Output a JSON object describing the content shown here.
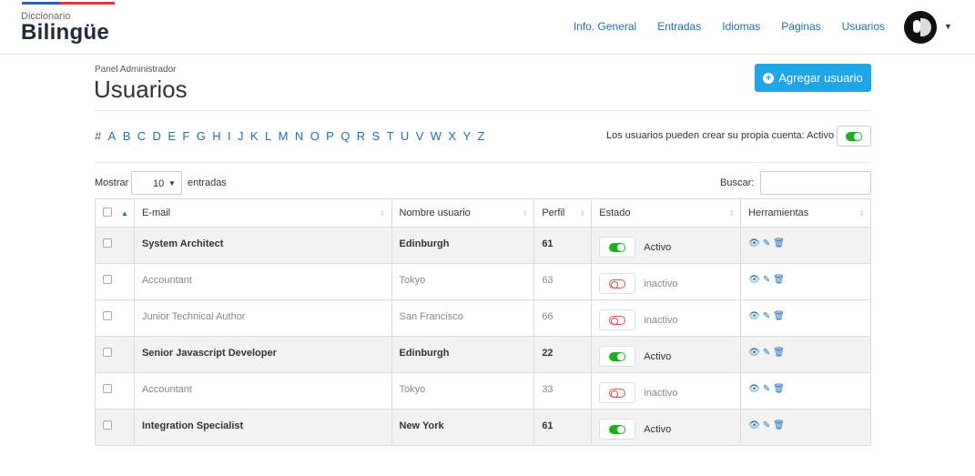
{
  "brand": {
    "small": "Diccionario",
    "big": "Bilingüe"
  },
  "nav": [
    "Info. General",
    "Entradas",
    "Idiomas",
    "Páginas",
    "Usuarios"
  ],
  "header": {
    "breadcrumb": "Panel Administrador",
    "title": "Usuarios",
    "add_button": "Agregar usuario"
  },
  "alphabet": [
    "#",
    "A",
    "B",
    "C",
    "D",
    "E",
    "F",
    "G",
    "H",
    "I",
    "J",
    "K",
    "L",
    "M",
    "N",
    "O",
    "P",
    "Q",
    "R",
    "S",
    "T",
    "U",
    "V",
    "W",
    "X",
    "Y",
    "Z"
  ],
  "self_register": {
    "label": "Los usuarios pueden crear su propia cuenta: Activo",
    "enabled": true
  },
  "controls": {
    "show_label": "Mostrar",
    "length_value": "10",
    "entries_label": "entradas",
    "search_label": "Buscar:",
    "search_value": ""
  },
  "table": {
    "columns": [
      "E-mail",
      "Nombre usuario",
      "Perfil",
      "Estado",
      "Herramientas"
    ],
    "rows": [
      {
        "email": "System Architect",
        "username": "Edinburgh",
        "profile": "61",
        "status": "Activo",
        "active": true
      },
      {
        "email": "Accountant",
        "username": "Tokyo",
        "profile": "63",
        "status": "inactivo",
        "active": false
      },
      {
        "email": "Junior Technical Author",
        "username": "San Francisco",
        "profile": "66",
        "status": "inactivo",
        "active": false
      },
      {
        "email": "Senior Javascript Developer",
        "username": "Edinburgh",
        "profile": "22",
        "status": "Activo",
        "active": true
      },
      {
        "email": "Accountant",
        "username": "Tokyo",
        "profile": "33",
        "status": "inactivo",
        "active": false
      },
      {
        "email": "Integration Specialist",
        "username": "New York",
        "profile": "61",
        "status": "Activo",
        "active": true
      }
    ],
    "tools": [
      "eye-icon",
      "edit-icon",
      "trash-icon"
    ]
  },
  "colors": {
    "accent": "#1fa6e6",
    "link": "#1f6fb2",
    "active_green": "#1bb11b",
    "inactive_red": "#e05050",
    "brand_blue": "#2a5fb8",
    "brand_red": "#e0353c"
  }
}
